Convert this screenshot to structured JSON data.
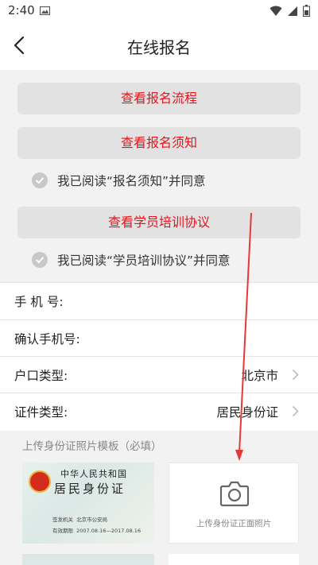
{
  "status_bar": {
    "time": "2:40"
  },
  "header": {
    "title": "在线报名"
  },
  "actions": {
    "view_process": "查看报名流程",
    "view_notice": "查看报名须知",
    "notice_agree": "我已阅读“报名须知”并同意",
    "view_agreement": "查看学员培训协议",
    "agreement_agree": "我已阅读“学员培训协议”并同意"
  },
  "form": {
    "phone_label": "手 机 号:",
    "confirm_phone_label": "确认手机号:",
    "hukou_label": "户口类型:",
    "hukou_value": "北京市",
    "id_type_label": "证件类型:",
    "id_type_value": "居民身份证"
  },
  "upload": {
    "title": "上传身份证照片模板（必填）",
    "front_hint": "上传身份证正面照片",
    "sample": {
      "country": "中华人民共和国",
      "card_name": "居民身份证",
      "issuer_label": "签发机关",
      "issuer_value": "北京市公安局",
      "valid_label": "有效期限",
      "valid_value": "2007.08.16—2017.08.16"
    }
  },
  "colors": {
    "accent": "#e8131b",
    "annotation": "#e53935",
    "section_bg": "#f2f2f2"
  }
}
